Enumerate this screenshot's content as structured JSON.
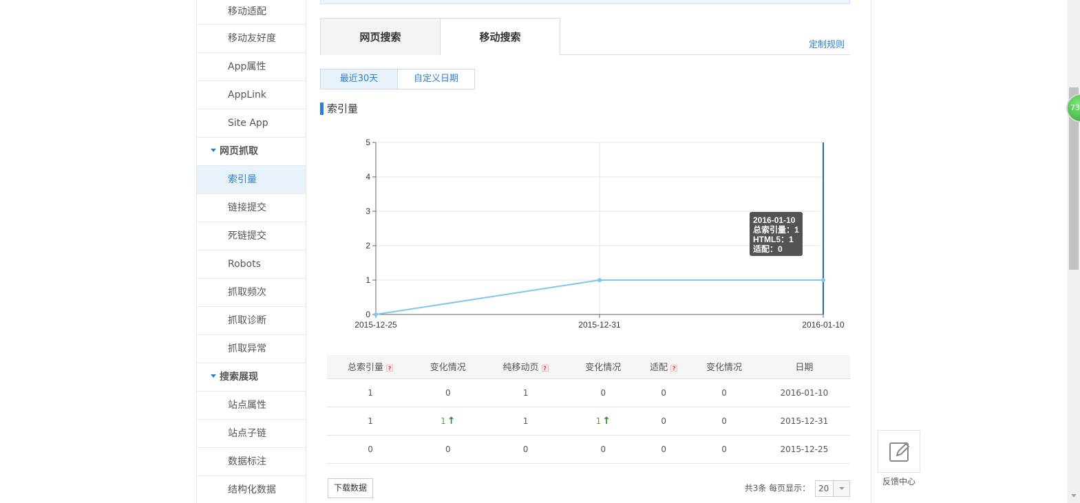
{
  "sidebar": {
    "items_top": [
      "移动适配",
      "移动友好度",
      "App属性",
      "AppLink",
      "Site App"
    ],
    "group1": "网页抓取",
    "items_crawl": [
      "索引量",
      "链接提交",
      "死链提交",
      "Robots",
      "抓取频次",
      "抓取诊断",
      "抓取异常"
    ],
    "group2": "搜索展现",
    "items_display": [
      "站点属性",
      "站点子链",
      "数据标注",
      "结构化数据"
    ]
  },
  "tabs": {
    "web": "网页搜索",
    "mobile": "移动搜索"
  },
  "custom_rule": "定制规则",
  "date_filter": {
    "recent": "最近30天",
    "custom": "自定义日期"
  },
  "section_title": "索引量",
  "chart_data": {
    "type": "line",
    "x": [
      "2015-12-25",
      "2015-12-31",
      "2016-01-10"
    ],
    "series": [
      {
        "values": [
          0,
          1,
          1
        ]
      }
    ],
    "ylim": [
      0,
      5
    ],
    "yticks": [
      "0",
      "1",
      "2",
      "3",
      "4",
      "5"
    ],
    "grid": true,
    "tooltip": {
      "date": "2016-01-10",
      "lines": [
        "总索引量：1",
        "HTML5：1",
        "适配：0"
      ]
    },
    "colors": {
      "line": "#7cc7ef",
      "highlight": "#1f6ba8",
      "tooltip_bg": "#4a4a4a"
    }
  },
  "table": {
    "headers": [
      "总索引量",
      "变化情况",
      "纯移动页",
      "变化情况",
      "适配",
      "变化情况",
      "日期"
    ],
    "rows": [
      [
        "1",
        "0",
        "1",
        "0",
        "0",
        "0",
        "2016-01-10"
      ],
      [
        "1",
        "1",
        "1",
        "1",
        "0",
        "0",
        "2015-12-31"
      ],
      [
        "0",
        "0",
        "0",
        "0",
        "0",
        "0",
        "2015-12-25"
      ]
    ]
  },
  "download_label": "下载数据",
  "pager": {
    "total": "共3条",
    "per_page_label": "每页显示：",
    "per_page": "20"
  },
  "feedback_label": "反馈中心",
  "badge": "73"
}
